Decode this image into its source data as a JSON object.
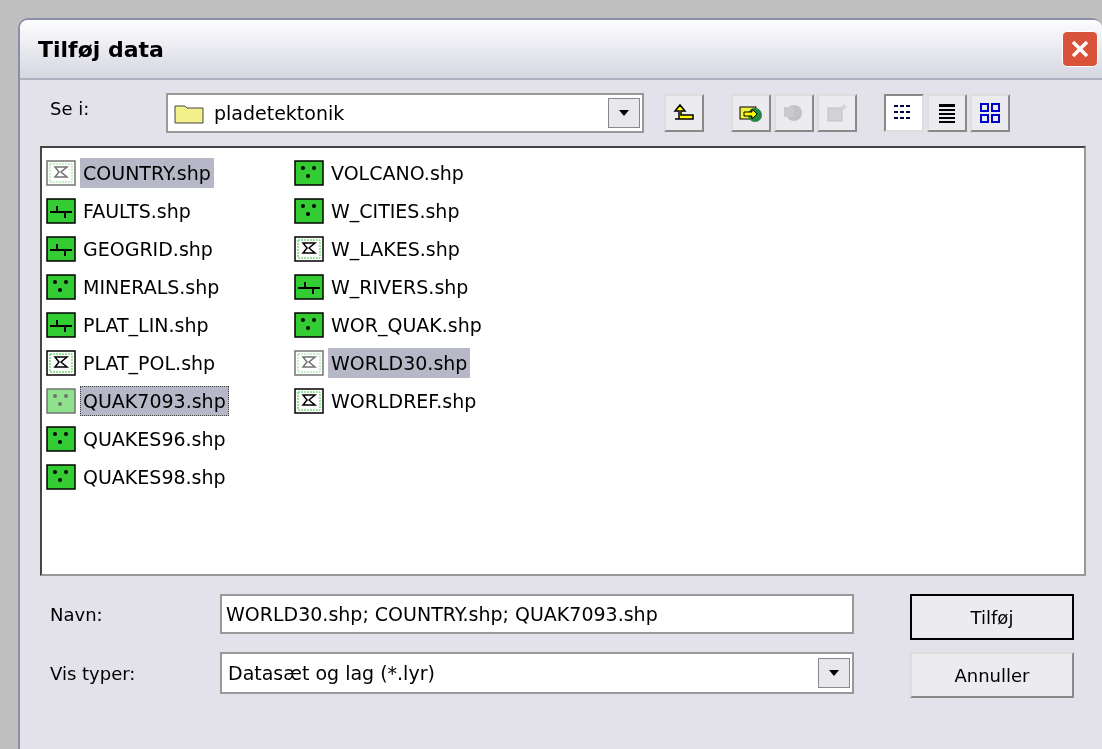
{
  "window": {
    "title": "Tilføj data"
  },
  "look_in": {
    "label": "Se i:",
    "value": "pladetektonik"
  },
  "toolbar_buttons": [
    {
      "kind": "up",
      "disabled": false,
      "selected": false
    },
    {
      "kind": "connect",
      "disabled": false,
      "selected": false
    },
    {
      "kind": "disconnect",
      "disabled": true,
      "selected": false
    },
    {
      "kind": "new",
      "disabled": true,
      "selected": false
    },
    {
      "kind": "list",
      "disabled": false,
      "selected": true
    },
    {
      "kind": "details",
      "disabled": false,
      "selected": false
    },
    {
      "kind": "thumbnails",
      "disabled": false,
      "selected": false
    }
  ],
  "files": [
    {
      "name": "COUNTRY.shp",
      "kind": "polygon",
      "selected": true,
      "focused": false
    },
    {
      "name": "FAULTS.shp",
      "kind": "line",
      "selected": false,
      "focused": false
    },
    {
      "name": "GEOGRID.shp",
      "kind": "line",
      "selected": false,
      "focused": false
    },
    {
      "name": "MINERALS.shp",
      "kind": "point",
      "selected": false,
      "focused": false
    },
    {
      "name": "PLAT_LIN.shp",
      "kind": "line",
      "selected": false,
      "focused": false
    },
    {
      "name": "PLAT_POL.shp",
      "kind": "polygon",
      "selected": false,
      "focused": false
    },
    {
      "name": "QUAK7093.shp",
      "kind": "point",
      "selected": true,
      "focused": true
    },
    {
      "name": "QUAKES96.shp",
      "kind": "point",
      "selected": false,
      "focused": false
    },
    {
      "name": "QUAKES98.shp",
      "kind": "point",
      "selected": false,
      "focused": false
    },
    {
      "name": "VOLCANO.shp",
      "kind": "point",
      "selected": false,
      "focused": false
    },
    {
      "name": "W_CITIES.shp",
      "kind": "point",
      "selected": false,
      "focused": false
    },
    {
      "name": "W_LAKES.shp",
      "kind": "polygon",
      "selected": false,
      "focused": false
    },
    {
      "name": "W_RIVERS.shp",
      "kind": "line",
      "selected": false,
      "focused": false
    },
    {
      "name": "WOR_QUAK.shp",
      "kind": "point",
      "selected": false,
      "focused": false
    },
    {
      "name": "WORLD30.shp",
      "kind": "polygon",
      "selected": true,
      "focused": false
    },
    {
      "name": "WORLDREF.shp",
      "kind": "polygon",
      "selected": false,
      "focused": false
    }
  ],
  "name_field": {
    "label": "Navn:",
    "value": "WORLD30.shp; COUNTRY.shp; QUAK7093.shp"
  },
  "type_field": {
    "label": "Vis typer:",
    "value": "Datasæt og lag (*.lyr)"
  },
  "buttons": [
    {
      "label": "Tilføj",
      "default": true
    },
    {
      "label": "Annuller",
      "default": false
    }
  ]
}
